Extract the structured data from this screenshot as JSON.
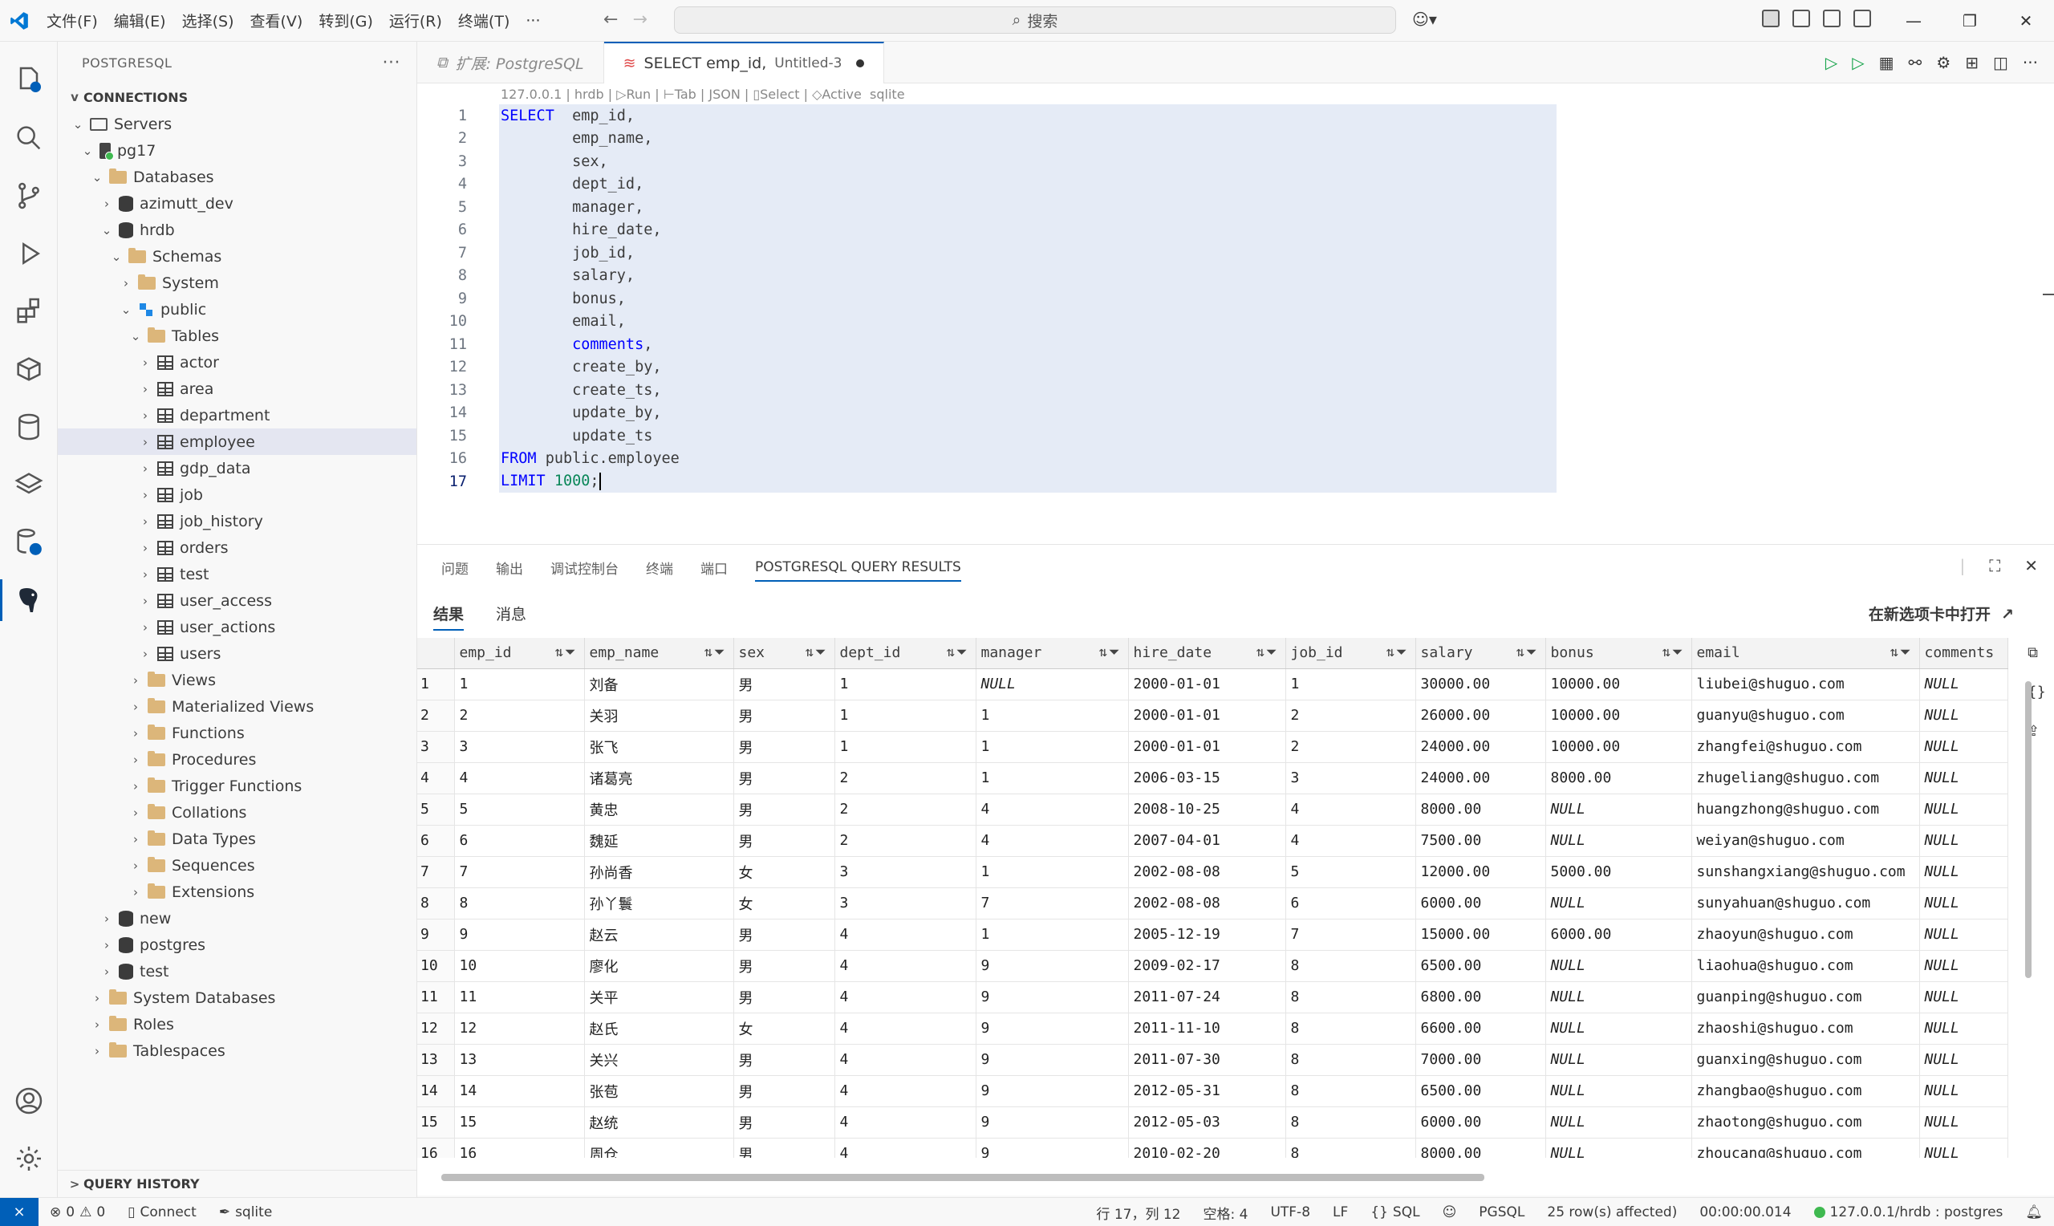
{
  "menu": [
    "文件(F)",
    "编辑(E)",
    "选择(S)",
    "查看(V)",
    "转到(G)",
    "运行(R)",
    "终端(T)",
    "···"
  ],
  "search_label": "搜索",
  "sidebar": {
    "title": "POSTGRESQL",
    "connections_label": "CONNECTIONS",
    "query_history_label": "QUERY HISTORY",
    "tree": [
      {
        "indent": 0,
        "chev": "v",
        "icon": "folder-outline",
        "label": "Servers"
      },
      {
        "indent": 1,
        "chev": "v",
        "icon": "server",
        "label": "pg17"
      },
      {
        "indent": 2,
        "chev": "v",
        "icon": "folder",
        "label": "Databases"
      },
      {
        "indent": 3,
        "chev": ">",
        "icon": "db",
        "label": "azimutt_dev"
      },
      {
        "indent": 3,
        "chev": "v",
        "icon": "db",
        "label": "hrdb"
      },
      {
        "indent": 4,
        "chev": "v",
        "icon": "folder",
        "label": "Schemas"
      },
      {
        "indent": 5,
        "chev": ">",
        "icon": "folder",
        "label": "System"
      },
      {
        "indent": 5,
        "chev": "v",
        "icon": "schema",
        "label": "public"
      },
      {
        "indent": 6,
        "chev": "v",
        "icon": "folder",
        "label": "Tables"
      },
      {
        "indent": 7,
        "chev": ">",
        "icon": "table",
        "label": "actor"
      },
      {
        "indent": 7,
        "chev": ">",
        "icon": "table",
        "label": "area"
      },
      {
        "indent": 7,
        "chev": ">",
        "icon": "table",
        "label": "department"
      },
      {
        "indent": 7,
        "chev": ">",
        "icon": "table",
        "label": "employee",
        "selected": true
      },
      {
        "indent": 7,
        "chev": ">",
        "icon": "table",
        "label": "gdp_data"
      },
      {
        "indent": 7,
        "chev": ">",
        "icon": "table",
        "label": "job"
      },
      {
        "indent": 7,
        "chev": ">",
        "icon": "table",
        "label": "job_history"
      },
      {
        "indent": 7,
        "chev": ">",
        "icon": "table",
        "label": "orders"
      },
      {
        "indent": 7,
        "chev": ">",
        "icon": "table",
        "label": "test"
      },
      {
        "indent": 7,
        "chev": ">",
        "icon": "table",
        "label": "user_access"
      },
      {
        "indent": 7,
        "chev": ">",
        "icon": "table",
        "label": "user_actions"
      },
      {
        "indent": 7,
        "chev": ">",
        "icon": "table",
        "label": "users"
      },
      {
        "indent": 6,
        "chev": ">",
        "icon": "folder",
        "label": "Views"
      },
      {
        "indent": 6,
        "chev": ">",
        "icon": "folder",
        "label": "Materialized Views"
      },
      {
        "indent": 6,
        "chev": ">",
        "icon": "folder",
        "label": "Functions"
      },
      {
        "indent": 6,
        "chev": ">",
        "icon": "folder",
        "label": "Procedures"
      },
      {
        "indent": 6,
        "chev": ">",
        "icon": "folder",
        "label": "Trigger Functions"
      },
      {
        "indent": 6,
        "chev": ">",
        "icon": "folder",
        "label": "Collations"
      },
      {
        "indent": 6,
        "chev": ">",
        "icon": "folder",
        "label": "Data Types"
      },
      {
        "indent": 6,
        "chev": ">",
        "icon": "folder",
        "label": "Sequences"
      },
      {
        "indent": 6,
        "chev": ">",
        "icon": "folder",
        "label": "Extensions"
      },
      {
        "indent": 3,
        "chev": ">",
        "icon": "db",
        "label": "new"
      },
      {
        "indent": 3,
        "chev": ">",
        "icon": "db",
        "label": "postgres"
      },
      {
        "indent": 3,
        "chev": ">",
        "icon": "db",
        "label": "test"
      },
      {
        "indent": 2,
        "chev": ">",
        "icon": "folder",
        "label": "System Databases"
      },
      {
        "indent": 2,
        "chev": ">",
        "icon": "folder",
        "label": "Roles"
      },
      {
        "indent": 2,
        "chev": ">",
        "icon": "folder",
        "label": "Tablespaces"
      }
    ]
  },
  "tabs": {
    "ext_tab": "扩展: PostgreSQL",
    "active_tab": "SELECT emp_id,",
    "active_tab_desc": "Untitled-3"
  },
  "editor": {
    "codelens": "127.0.0.1 | hrdb | ▷Run | ⊢Tab | JSON | ▯Select | ◇Active  sqlite",
    "lines": [
      [
        [
          "kw",
          "SELECT"
        ],
        [
          "",
          "  emp_id,"
        ]
      ],
      [
        [
          "",
          "        emp_name,"
        ]
      ],
      [
        [
          "",
          "        sex,"
        ]
      ],
      [
        [
          "",
          "        dept_id,"
        ]
      ],
      [
        [
          "",
          "        manager,"
        ]
      ],
      [
        [
          "",
          "        hire_date,"
        ]
      ],
      [
        [
          "",
          "        job_id,"
        ]
      ],
      [
        [
          "",
          "        salary,"
        ]
      ],
      [
        [
          "",
          "        bonus,"
        ]
      ],
      [
        [
          "",
          "        email,"
        ]
      ],
      [
        [
          "",
          "        "
        ],
        [
          "kw",
          "comments"
        ],
        [
          "",
          ","
        ]
      ],
      [
        [
          "",
          "        create_by,"
        ]
      ],
      [
        [
          "",
          "        create_ts,"
        ]
      ],
      [
        [
          "",
          "        update_by,"
        ]
      ],
      [
        [
          "",
          "        update_ts"
        ]
      ],
      [
        [
          "kw",
          "FROM"
        ],
        [
          "",
          " public.employee"
        ]
      ],
      [
        [
          "kw",
          "LIMIT"
        ],
        [
          "",
          " "
        ],
        [
          "num",
          "1000"
        ],
        [
          "",
          ";"
        ]
      ]
    ]
  },
  "panel": {
    "tabs": [
      "问题",
      "输出",
      "调试控制台",
      "终端",
      "端口",
      "POSTGRESQL QUERY RESULTS"
    ],
    "result_tabs": [
      "结果",
      "消息"
    ],
    "open_in_tab": "在新选项卡中打开",
    "columns": [
      "emp_id",
      "emp_name",
      "sex",
      "dept_id",
      "manager",
      "hire_date",
      "job_id",
      "salary",
      "bonus",
      "email",
      "comments"
    ],
    "rows": [
      [
        "1",
        "1",
        "刘备",
        "男",
        "1",
        "NULL",
        "2000-01-01",
        "1",
        "30000.00",
        "10000.00",
        "liubei@shuguo.com",
        "NULL"
      ],
      [
        "2",
        "2",
        "关羽",
        "男",
        "1",
        "1",
        "2000-01-01",
        "2",
        "26000.00",
        "10000.00",
        "guanyu@shuguo.com",
        "NULL"
      ],
      [
        "3",
        "3",
        "张飞",
        "男",
        "1",
        "1",
        "2000-01-01",
        "2",
        "24000.00",
        "10000.00",
        "zhangfei@shuguo.com",
        "NULL"
      ],
      [
        "4",
        "4",
        "诸葛亮",
        "男",
        "2",
        "1",
        "2006-03-15",
        "3",
        "24000.00",
        "8000.00",
        "zhugeliang@shuguo.com",
        "NULL"
      ],
      [
        "5",
        "5",
        "黄忠",
        "男",
        "2",
        "4",
        "2008-10-25",
        "4",
        "8000.00",
        "NULL",
        "huangzhong@shuguo.com",
        "NULL"
      ],
      [
        "6",
        "6",
        "魏延",
        "男",
        "2",
        "4",
        "2007-04-01",
        "4",
        "7500.00",
        "NULL",
        "weiyan@shuguo.com",
        "NULL"
      ],
      [
        "7",
        "7",
        "孙尚香",
        "女",
        "3",
        "1",
        "2002-08-08",
        "5",
        "12000.00",
        "5000.00",
        "sunshangxiang@shuguo.com",
        "NULL"
      ],
      [
        "8",
        "8",
        "孙丫鬟",
        "女",
        "3",
        "7",
        "2002-08-08",
        "6",
        "6000.00",
        "NULL",
        "sunyahuan@shuguo.com",
        "NULL"
      ],
      [
        "9",
        "9",
        "赵云",
        "男",
        "4",
        "1",
        "2005-12-19",
        "7",
        "15000.00",
        "6000.00",
        "zhaoyun@shuguo.com",
        "NULL"
      ],
      [
        "10",
        "10",
        "廖化",
        "男",
        "4",
        "9",
        "2009-02-17",
        "8",
        "6500.00",
        "NULL",
        "liaohua@shuguo.com",
        "NULL"
      ],
      [
        "11",
        "11",
        "关平",
        "男",
        "4",
        "9",
        "2011-07-24",
        "8",
        "6800.00",
        "NULL",
        "guanping@shuguo.com",
        "NULL"
      ],
      [
        "12",
        "12",
        "赵氏",
        "女",
        "4",
        "9",
        "2011-11-10",
        "8",
        "6600.00",
        "NULL",
        "zhaoshi@shuguo.com",
        "NULL"
      ],
      [
        "13",
        "13",
        "关兴",
        "男",
        "4",
        "9",
        "2011-07-30",
        "8",
        "7000.00",
        "NULL",
        "guanxing@shuguo.com",
        "NULL"
      ],
      [
        "14",
        "14",
        "张苞",
        "男",
        "4",
        "9",
        "2012-05-31",
        "8",
        "6500.00",
        "NULL",
        "zhangbao@shuguo.com",
        "NULL"
      ],
      [
        "15",
        "15",
        "赵统",
        "男",
        "4",
        "9",
        "2012-05-03",
        "8",
        "6000.00",
        "NULL",
        "zhaotong@shuguo.com",
        "NULL"
      ],
      [
        "16",
        "16",
        "周仓",
        "男",
        "4",
        "9",
        "2010-02-20",
        "8",
        "8000.00",
        "NULL",
        "zhoucang@shuguo.com",
        "NULL"
      ]
    ]
  },
  "status": {
    "errors": "0",
    "warnings": "0",
    "connect": "Connect",
    "sqlite": "sqlite",
    "position": "行 17，列 12",
    "spaces": "空格: 4",
    "encoding": "UTF-8",
    "eol": "LF",
    "language": "SQL",
    "pgsql": "PGSQL",
    "rows_affected": "25 row(s) affected)",
    "duration": "00:00:00.014",
    "connection": "127.0.0.1/hrdb : postgres"
  }
}
